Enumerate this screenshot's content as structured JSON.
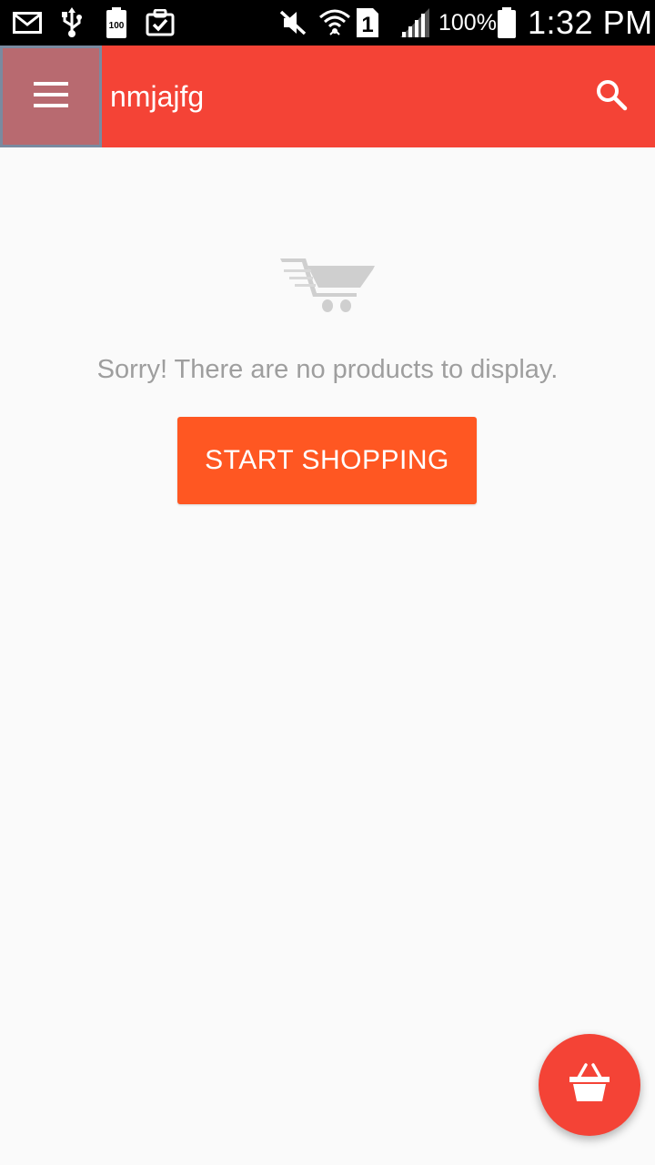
{
  "status_bar": {
    "battery_percent": "100%",
    "time": "1:32 PM",
    "icons": [
      "mail-icon",
      "usb-icon",
      "battery-100-icon",
      "clipboard-check-icon",
      "mute-icon",
      "wifi-icon",
      "sim-1-icon",
      "signal-icon",
      "battery-icon"
    ]
  },
  "app_bar": {
    "title": "nmjajfg",
    "menu_icon": "hamburger-menu-icon",
    "search_icon": "search-icon",
    "background_color": "#f44336"
  },
  "empty_state": {
    "icon": "shopping-cart-icon",
    "message": "Sorry! There are no products to display.",
    "button_label": "START SHOPPING",
    "button_color": "#ff5722"
  },
  "fab": {
    "icon": "shopping-basket-icon",
    "color": "#f44336"
  }
}
